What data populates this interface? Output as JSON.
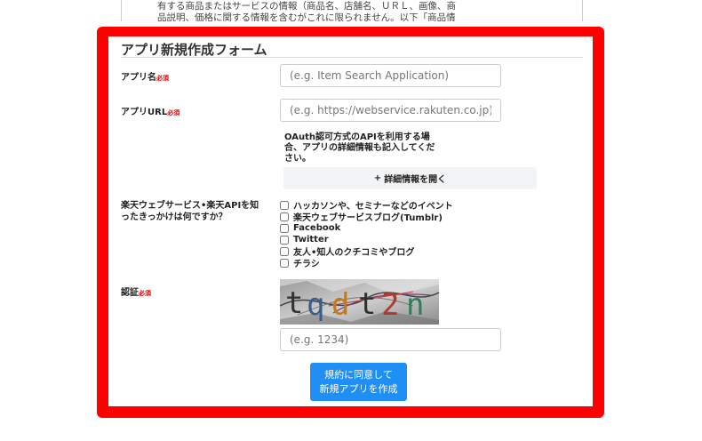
{
  "terms": {
    "line1": "有する商品またはサービスの情報（商品名、店舗名、ＵＲＬ、画像、商",
    "line2": "品説明、価格に関する情報を含むがこれに限られません。以下「商品情"
  },
  "form": {
    "title": "アプリ新規作成フォーム",
    "required_mark": "必須",
    "app_name": {
      "label": "アプリ名",
      "placeholder": "(e.g. Item Search Application)",
      "value": ""
    },
    "app_url": {
      "label": "アプリURL",
      "placeholder": "(e.g. https://webservice.rakuten.co.jp)",
      "value": ""
    },
    "oauth_note": "OAuth認可方式のAPIを利用する場合、アプリの詳細情報も記入してください。",
    "details_button": {
      "icon": "plus-icon",
      "label": "詳細情報を開く"
    },
    "question": {
      "label": "楽天ウェブサービス•楽天APIを知ったきっかけは何ですか？",
      "options": [
        "ハッカソンや、セミナーなどのイベント",
        "楽天ウェブサービスブログ(Tumblr)",
        "Facebook",
        "Twitter",
        "友人•知人のクチコミやブログ",
        "チラシ"
      ]
    },
    "captcha": {
      "label": "認証",
      "image_text": "tqdt2n",
      "placeholder": "(e.g. 1234)",
      "value": ""
    },
    "submit": {
      "line1": "規約に同意して",
      "line2": "新規アプリを作成"
    }
  },
  "colors": {
    "highlight_frame": "#ff0000",
    "required": "#dd0000",
    "primary_button": "#1f8ff5"
  }
}
